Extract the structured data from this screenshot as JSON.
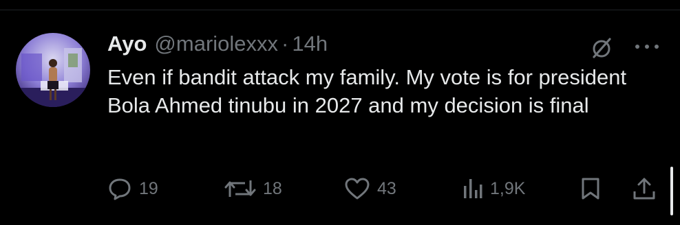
{
  "tweet": {
    "author_name": "Ayo",
    "handle": "@mariolexxx",
    "separator": "·",
    "time": "14h",
    "text": "Even if bandit attack my family. My vote is for president Bola Ahmed tinubu in 2027 and my decision is final"
  },
  "actions": {
    "replies": "19",
    "reposts": "18",
    "likes": "43",
    "views": "1,9K"
  },
  "icons": {
    "reply": "reply-icon",
    "repost": "repost-icon",
    "like": "heart-icon",
    "views": "views-chart-icon",
    "bookmark": "bookmark-icon",
    "share": "share-icon",
    "grok": "grok-icon",
    "more": "more-icon"
  },
  "colors": {
    "background": "#000000",
    "text_primary": "#e7e9ea",
    "text_secondary": "#71767b"
  }
}
